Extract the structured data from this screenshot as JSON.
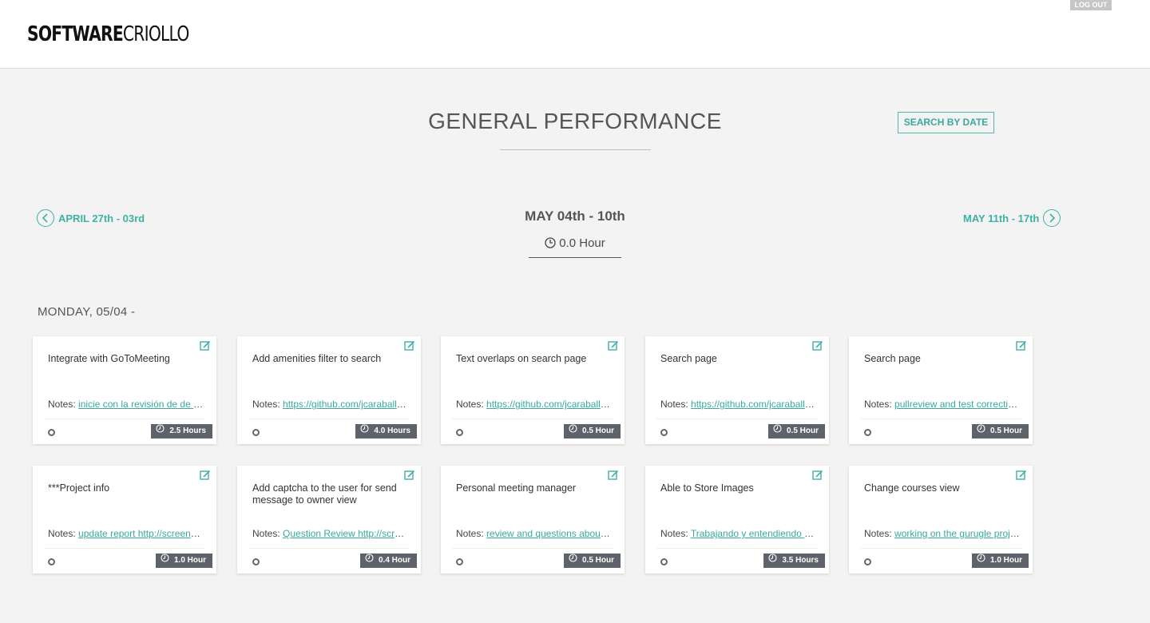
{
  "header": {
    "logo_bold": "SOFTWARE",
    "logo_light": "CRIOLLO",
    "logout_label": "LOG OUT"
  },
  "page": {
    "title": "GENERAL PERFORMANCE",
    "search_by_date_label": "SEARCH BY DATE"
  },
  "week_nav": {
    "prev_label": "APRIL 27th - 03rd",
    "current_label": "MAY 04th - 10th",
    "current_hours": "0.0 Hour",
    "next_label": "MAY 11th - 17th"
  },
  "day": {
    "heading": "MONDAY, 05/04 -"
  },
  "notes_prefix": "Notes:",
  "colors": {
    "accent": "#3fb1a6",
    "hours_badge": "#5e626b",
    "background": "#f3f3f3"
  },
  "cards": [
    {
      "title": "Integrate with GoToMeeting",
      "note": "inicie con la revisión de de la ...",
      "hours": "2.5 Hours"
    },
    {
      "title": "Add amenities filter to search",
      "note": "https://github.com/jcaraballo...",
      "hours": "4.0 Hours"
    },
    {
      "title": "Text overlaps on search page",
      "note": "https://github.com/jcaraballo...",
      "hours": "0.5 Hour"
    },
    {
      "title": "Search page",
      "note": "https://github.com/jcaraballo...",
      "hours": "0.5 Hour"
    },
    {
      "title": "Search page",
      "note": "pullreview and test correction...",
      "hours": "0.5 Hour"
    },
    {
      "title": "***Project info",
      "note": "update report http://screencl...",
      "hours": "1.0 Hour"
    },
    {
      "title": "Add captcha to the user for send message to owner view",
      "note": "Question Review http://scree...",
      "hours": "0.4 Hour"
    },
    {
      "title": "Personal meeting manager",
      "note": "review and questions about c...",
      "hours": "0.5 Hour"
    },
    {
      "title": "Able to Store Images",
      "note": "Trabajando y entendiendo el ...",
      "hours": "3.5 Hours"
    },
    {
      "title": "Change courses view",
      "note": "working on the gurugle proje...",
      "hours": "1.0 Hour"
    }
  ]
}
